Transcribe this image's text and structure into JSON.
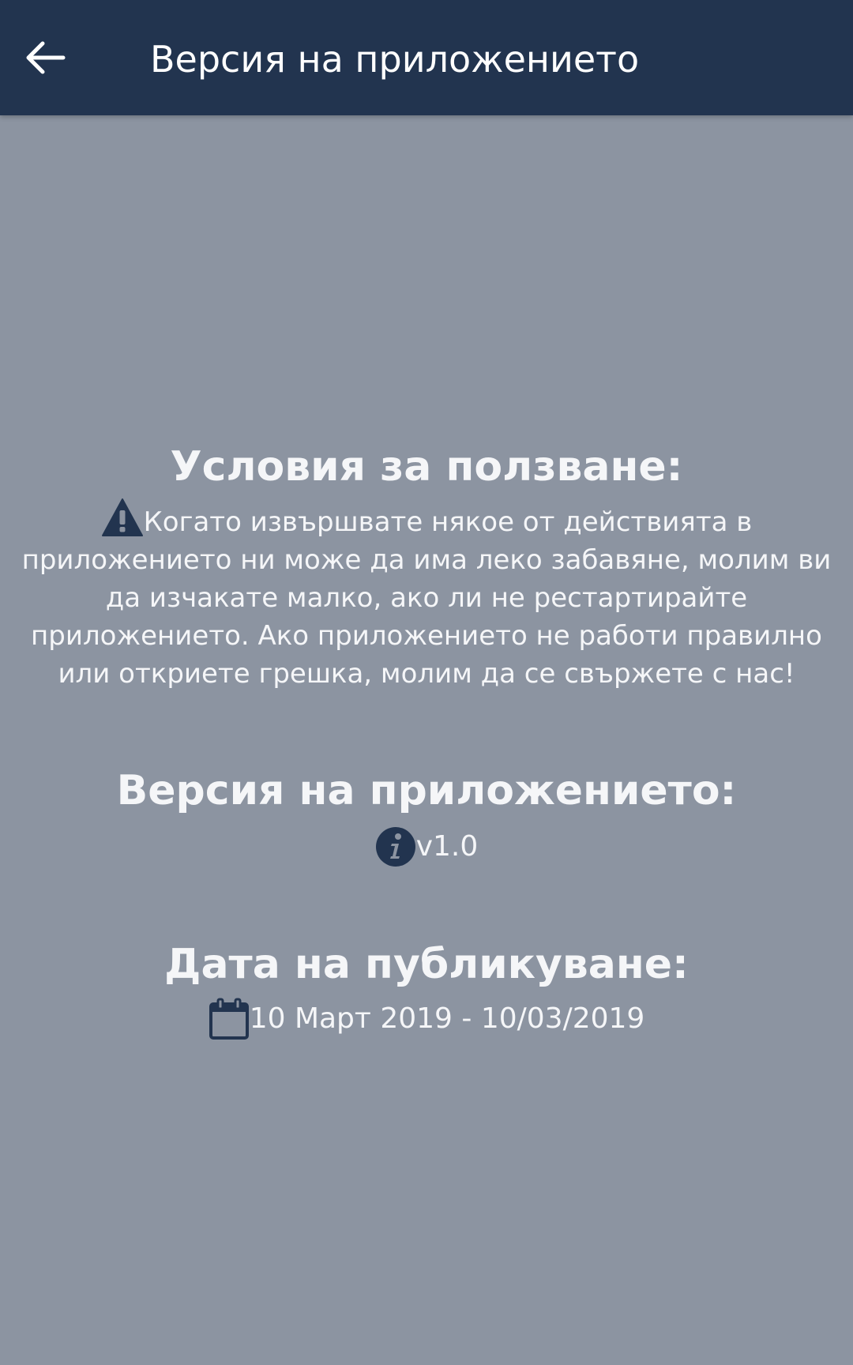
{
  "app_bar": {
    "title": "Версия на приложението",
    "back_icon": "arrow-left-icon"
  },
  "terms": {
    "heading": "Условия за ползване:",
    "icon": "warning-icon",
    "text": "Когато извършвате някое от действията в приложението ни може да има леко забавяне, молим ви да изчакате малко, ако ли не рестартирайте приложението. Ако приложението не работи правилно или откриете грешка, молим да се свържете с нас!"
  },
  "version": {
    "heading": "Версия на приложението:",
    "icon": "info-icon",
    "value": "v1.0"
  },
  "publish_date": {
    "heading": "Дата на публикуване:",
    "icon": "calendar-icon",
    "value": "10 Март 2019 - 10/03/2019"
  },
  "colors": {
    "app_bar": "#22344f",
    "background": "#8c94a1",
    "icon": "#22344f",
    "text": "#f5f6f8"
  }
}
